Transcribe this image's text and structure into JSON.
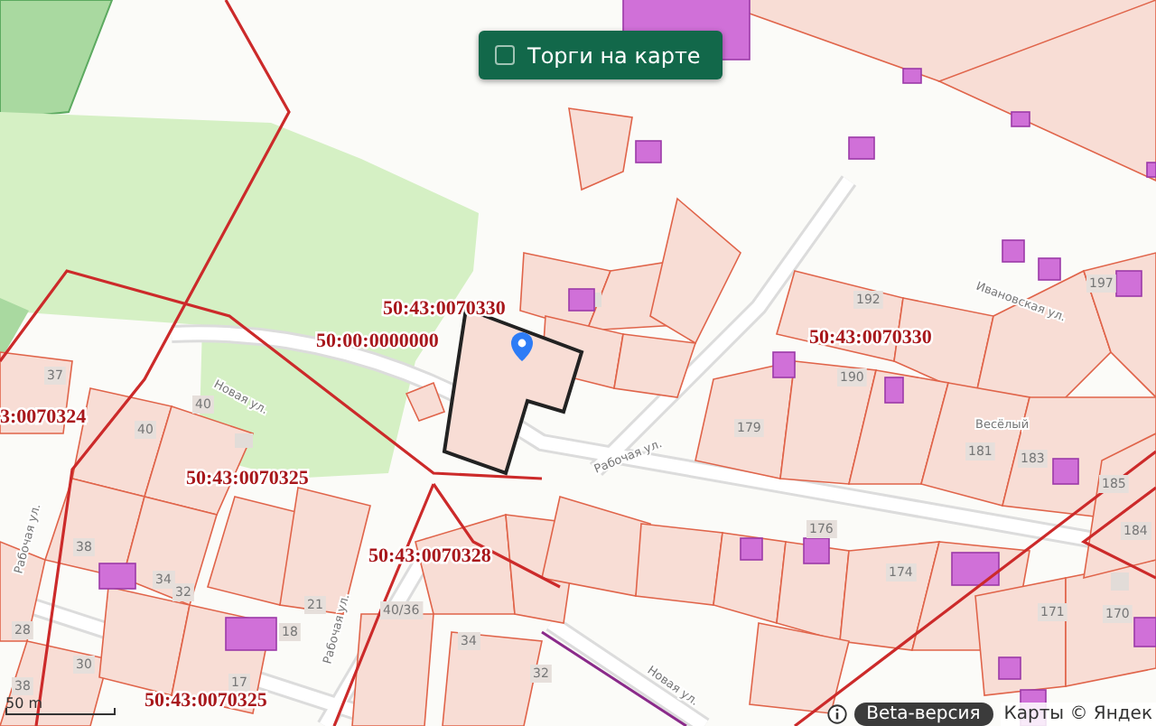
{
  "trade_toggle": {
    "label": "Торги на карте",
    "checked": false
  },
  "cadastral_labels": [
    {
      "text": "50:43:0070330"
    },
    {
      "text": "50:00:0000000"
    },
    {
      "text": "50:43:0070330"
    },
    {
      "text": "3:0070324"
    },
    {
      "text": "50:43:0070325"
    },
    {
      "text": "50:43:0070328"
    },
    {
      "text": "50:43:0070325"
    }
  ],
  "street_labels": [
    {
      "text": "Рабочая ул."
    },
    {
      "text": "Новая ул."
    },
    {
      "text": "Ивановская ул."
    },
    {
      "text": "Рабочая ул."
    },
    {
      "text": "Рабочая ул."
    },
    {
      "text": "Новая ул."
    }
  ],
  "area_label": "Весёлый",
  "house_numbers": [
    "192",
    "197",
    "190",
    "179",
    "181",
    "183",
    "185",
    "176",
    "174",
    "171",
    "170",
    "184",
    "37",
    "40",
    "40",
    "38",
    "34",
    "28",
    "30",
    "32",
    "17",
    "18",
    "21",
    "40/36",
    "34",
    "32",
    "38"
  ],
  "scale": {
    "label": "50 m"
  },
  "footer": {
    "beta_badge": "Beta-версия",
    "attribution": "Карты © Яндек"
  }
}
